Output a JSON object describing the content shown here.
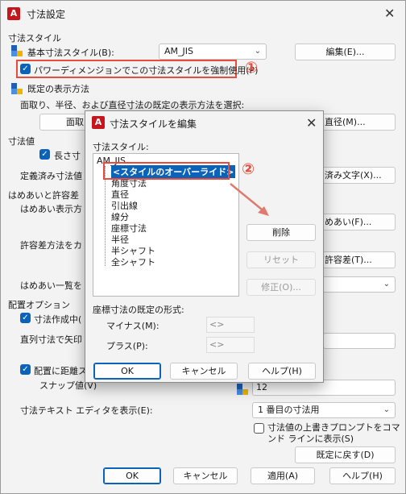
{
  "window": {
    "app_icon": "A",
    "title": "寸法設定",
    "close": "✕"
  },
  "sections": {
    "dimstyle": "寸法スタイル",
    "default_display": "既定の表示方法",
    "dim_value": "寸法値",
    "fit_tolerance": "はめあいと許容差",
    "placement": "配置オプション"
  },
  "main": {
    "base_style_label": "基本寸法スタイル(B):",
    "base_style_value": "AM_JIS",
    "edit_button": "編集(E)...",
    "force_checkbox_label": "パワーディメンジョンでこの寸法スタイルを強制使用(P)",
    "force_checkbox_checked": true,
    "marker1": "①",
    "marker2": "②",
    "default_display_desc": "面取り、半径、および直径寸法の既定の表示方法を選択:",
    "chamfer_button": "面取",
    "diameter_button": "直径(M)...",
    "long_dim_label": "長さ寸",
    "predefined_label": "定義済み寸法値",
    "predefined_button": "済み文字(X)...",
    "fit_display_label": "はめあい表示方",
    "fit_button": "めあい(F)...",
    "tol_method_label": "許容差方法をカ",
    "tol_button": "許容差(T)...",
    "fit_list_label": "はめあい一覧を",
    "create_label": "寸法作成中(",
    "series_label": "直列寸法で矢印",
    "place_dist_label": "配置に距離ス",
    "snap_label": "スナップ値(V)",
    "snap_value": "12",
    "text_editor_label": "寸法テキスト エディタを表示(E):",
    "text_editor_value": "1 番目の寸法用",
    "overwrite_label_1": "寸法値の上書きプロンプトをコマ",
    "overwrite_label_2": "ンド ラインに表示(S)",
    "restore_button": "既定に戻す(D)",
    "ok_button": "OK",
    "cancel_button": "キャンセル",
    "apply_button": "適用(A)",
    "help_button": "ヘルプ(H)"
  },
  "dialog": {
    "title": "寸法スタイルを編集",
    "close": "✕",
    "list_label": "寸法スタイル:",
    "root_item": "AM_JIS",
    "items": [
      {
        "label": "<スタイルのオーバーライド>",
        "selected": true
      },
      {
        "label": "角度寸法",
        "selected": false
      },
      {
        "label": "直径",
        "selected": false
      },
      {
        "label": "引出線",
        "selected": false
      },
      {
        "label": "線分",
        "selected": false
      },
      {
        "label": "座標寸法",
        "selected": false
      },
      {
        "label": "半径",
        "selected": false
      },
      {
        "label": "半シャフト",
        "selected": false
      },
      {
        "label": "全シャフト",
        "selected": false
      }
    ],
    "delete_button": "削除",
    "reset_button": "リセット",
    "modify_button": "修正(O)...",
    "coord_format_label": "座標寸法の既定の形式:",
    "minus_label": "マイナス(M):",
    "minus_value": "<>",
    "plus_label": "プラス(P):",
    "plus_value": "<>",
    "ok_button": "OK",
    "cancel_button": "キャンセル",
    "help_button": "ヘルプ(H)"
  },
  "colors": {
    "accent": "#0a63b8",
    "annotation_red": "#e74c3c",
    "app_icon_red": "#c4161c"
  }
}
